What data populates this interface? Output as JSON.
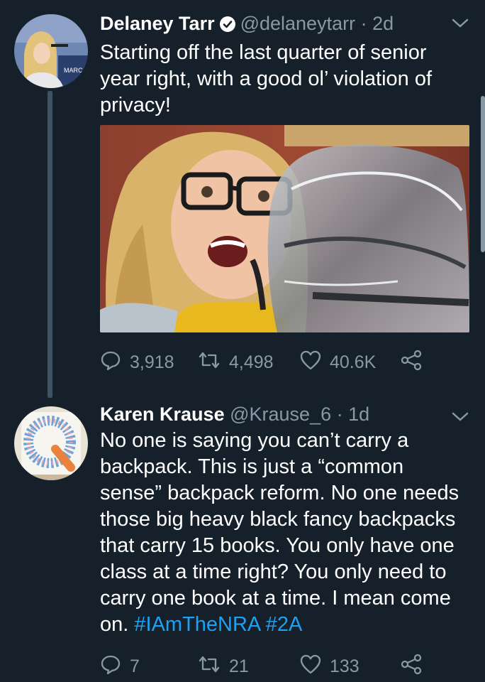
{
  "tweets": [
    {
      "name": "Delaney Tarr",
      "handle": "@delaneytarr",
      "time": "· 2d",
      "text": "Starting off the last quarter of senior year right, with a good ol’ violation of privacy!",
      "avatar_sign": "MARC",
      "stats": {
        "replies": "3,918",
        "retweets": "4,498",
        "likes": "40.6K"
      }
    },
    {
      "name": "Karen Krause",
      "handle": "@Krause_6",
      "time": "· 1d",
      "text": "No one is saying you can’t carry a backpack. This is just a “common sense” backpack reform. No one needs those big heavy black fancy backpacks that carry 15 books. You only have one class at a time right? You only need to carry one book at a time. I mean come on.",
      "hashtags": [
        "#IAmTheNRA",
        "#2A"
      ],
      "stats": {
        "replies": "7",
        "retweets": "21",
        "likes": "133"
      }
    }
  ],
  "icons": [
    "verified-badge-icon",
    "chevron-down-icon",
    "reply-icon",
    "retweet-icon",
    "like-icon",
    "share-icon"
  ],
  "colors": {
    "background": "#15202b",
    "secondary_text": "#8899a6",
    "link": "#1da1f2",
    "thread_line": "#3d5466"
  }
}
